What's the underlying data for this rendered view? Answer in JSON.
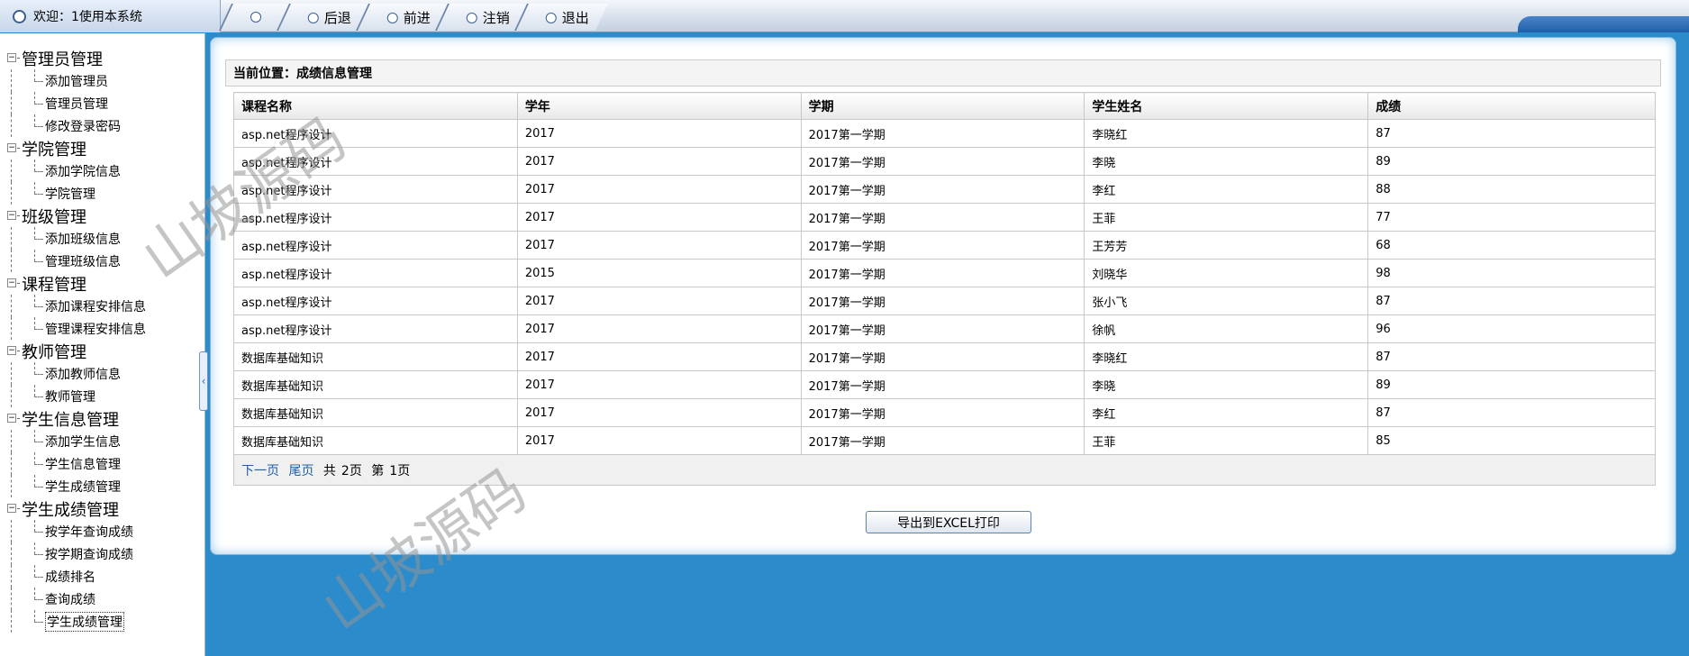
{
  "topbar": {
    "welcome": "欢迎：1使用本系统",
    "nav": [
      "",
      "后退",
      "前进",
      "注销",
      "退出"
    ]
  },
  "sidebar": {
    "groups": [
      {
        "title": "管理员管理",
        "items": [
          "添加管理员",
          "管理员管理",
          "修改登录密码"
        ]
      },
      {
        "title": "学院管理",
        "items": [
          "添加学院信息",
          "学院管理"
        ]
      },
      {
        "title": "班级管理",
        "items": [
          "添加班级信息",
          "管理班级信息"
        ]
      },
      {
        "title": "课程管理",
        "items": [
          "添加课程安排信息",
          "管理课程安排信息"
        ]
      },
      {
        "title": "教师管理",
        "items": [
          "添加教师信息",
          "教师管理"
        ]
      },
      {
        "title": "学生信息管理",
        "items": [
          "添加学生信息",
          "学生信息管理",
          "学生成绩管理"
        ]
      },
      {
        "title": "学生成绩管理",
        "items": [
          "按学年查询成绩",
          "按学期查询成绩",
          "成绩排名",
          "查询成绩",
          "学生成绩管理"
        ]
      }
    ]
  },
  "main": {
    "breadcrumb": "当前位置：成绩信息管理",
    "table": {
      "headers": [
        "课程名称",
        "学年",
        "学期",
        "学生姓名",
        "成绩"
      ],
      "rows": [
        [
          "asp.net程序设计",
          "2017",
          "2017第一学期",
          "李晓红",
          "87"
        ],
        [
          "asp.net程序设计",
          "2017",
          "2017第一学期",
          "李晓",
          "89"
        ],
        [
          "asp.net程序设计",
          "2017",
          "2017第一学期",
          "李红",
          "88"
        ],
        [
          "asp.net程序设计",
          "2017",
          "2017第一学期",
          "王菲",
          "77"
        ],
        [
          "asp.net程序设计",
          "2017",
          "2017第一学期",
          "王芳芳",
          "68"
        ],
        [
          "asp.net程序设计",
          "2015",
          "2017第一学期",
          "刘晓华",
          "98"
        ],
        [
          "asp.net程序设计",
          "2017",
          "2017第一学期",
          "张小飞",
          "87"
        ],
        [
          "asp.net程序设计",
          "2017",
          "2017第一学期",
          "徐帆",
          "96"
        ],
        [
          "数据库基础知识",
          "2017",
          "2017第一学期",
          "李晓红",
          "87"
        ],
        [
          "数据库基础知识",
          "2017",
          "2017第一学期",
          "李晓",
          "89"
        ],
        [
          "数据库基础知识",
          "2017",
          "2017第一学期",
          "李红",
          "87"
        ],
        [
          "数据库基础知识",
          "2017",
          "2017第一学期",
          "王菲",
          "85"
        ]
      ]
    },
    "pager": {
      "next": "下一页",
      "last": "尾页",
      "total_prefix": "共",
      "total": "2页",
      "page_prefix": "第",
      "page": "1页"
    },
    "export_label": "导出到EXCEL打印"
  },
  "watermark": "山坡源码"
}
